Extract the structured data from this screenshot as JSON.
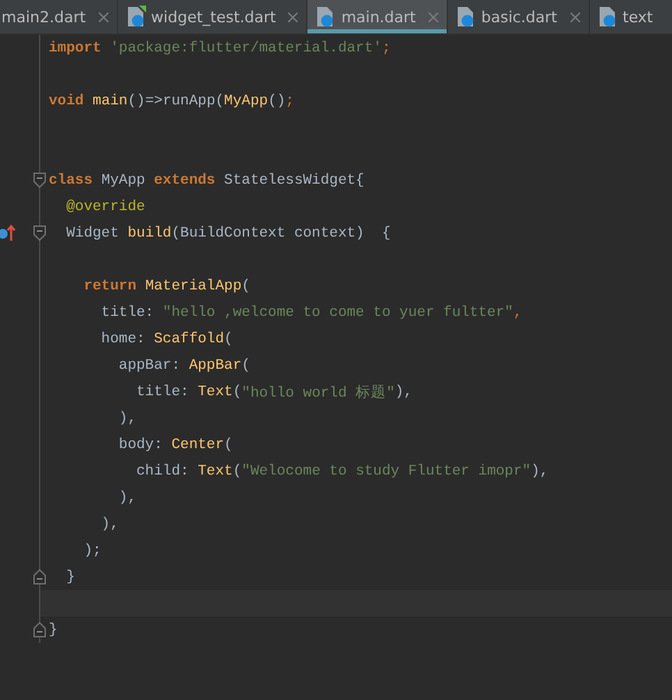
{
  "tabs": [
    {
      "label": "main2.dart",
      "selected": false,
      "icon": false,
      "cut": false
    },
    {
      "label": "widget_test.dart",
      "selected": false,
      "icon": true,
      "badge": true,
      "cut": false
    },
    {
      "label": "main.dart",
      "selected": true,
      "icon": true,
      "badge": false,
      "cut": false
    },
    {
      "label": "basic.dart",
      "selected": false,
      "icon": true,
      "badge": false,
      "cut": false
    },
    {
      "label": "text",
      "selected": false,
      "icon": true,
      "badge": false,
      "cut": true
    }
  ],
  "lines": [
    {
      "tokens": [
        {
          "kind": "keyword",
          "text": "import"
        },
        {
          "kind": "string",
          "text": " 'package:flutter/material.dart'"
        },
        {
          "kind": "punct",
          "text": ";"
        }
      ]
    },
    {
      "kind": "blank"
    },
    {
      "tokens": [
        {
          "kind": "keyword",
          "text": "void"
        },
        {
          "kind": "func",
          "text": " main"
        },
        {
          "kind": "plain",
          "text": "()=>runApp("
        },
        {
          "kind": "func",
          "text": "MyApp"
        },
        {
          "kind": "plain",
          "text": "()"
        },
        {
          "kind": "punct",
          "text": ";"
        }
      ]
    },
    {
      "kind": "blank"
    },
    {
      "kind": "blank"
    },
    {
      "gutter": [
        {
          "kind": "fold_start"
        }
      ],
      "tokens": [
        {
          "kind": "keyword",
          "text": "class"
        },
        {
          "kind": "plain",
          "text": " MyApp "
        },
        {
          "kind": "keyword",
          "text": "extends"
        },
        {
          "kind": "plain",
          "text": " StatelessWidget{"
        }
      ]
    },
    {
      "tokens": [
        {
          "kind": "annotation",
          "text": "  @override"
        }
      ]
    },
    {
      "gutter": [
        {
          "kind": "override_marker"
        },
        {
          "kind": "fold_start"
        }
      ],
      "tokens": [
        {
          "kind": "plain",
          "text": "  Widget "
        },
        {
          "kind": "func",
          "text": "build"
        },
        {
          "kind": "plain",
          "text": "(BuildContext context)  {"
        }
      ]
    },
    {
      "kind": "blank"
    },
    {
      "tokens": [
        {
          "kind": "keyword",
          "text": "    return"
        },
        {
          "kind": "func",
          "text": " MaterialApp"
        },
        {
          "kind": "plain",
          "text": "("
        }
      ]
    },
    {
      "tokens": [
        {
          "kind": "plain",
          "text": "      title: "
        },
        {
          "kind": "string",
          "text": "\"hello ,welcome to come to yuer fultter\""
        },
        {
          "kind": "punct",
          "text": ","
        }
      ]
    },
    {
      "tokens": [
        {
          "kind": "plain",
          "text": "      home: "
        },
        {
          "kind": "func",
          "text": "Scaffold"
        },
        {
          "kind": "plain",
          "text": "("
        }
      ]
    },
    {
      "tokens": [
        {
          "kind": "plain",
          "text": "        appBar: "
        },
        {
          "kind": "func",
          "text": "AppBar"
        },
        {
          "kind": "plain",
          "text": "("
        }
      ]
    },
    {
      "tokens": [
        {
          "kind": "plain",
          "text": "          title: "
        },
        {
          "kind": "func",
          "text": "Text"
        },
        {
          "kind": "plain",
          "text": "("
        },
        {
          "kind": "string",
          "text": "\"hollo world 标题\""
        },
        {
          "kind": "plain",
          "text": "),"
        }
      ]
    },
    {
      "tokens": [
        {
          "kind": "plain",
          "text": "        ),"
        }
      ]
    },
    {
      "tokens": [
        {
          "kind": "plain",
          "text": "        body: "
        },
        {
          "kind": "func",
          "text": "Center"
        },
        {
          "kind": "plain",
          "text": "("
        }
      ]
    },
    {
      "tokens": [
        {
          "kind": "plain",
          "text": "          child: "
        },
        {
          "kind": "func",
          "text": "Text"
        },
        {
          "kind": "plain",
          "text": "("
        },
        {
          "kind": "string",
          "text": "\"Welocome to study Flutter imopr\""
        },
        {
          "kind": "plain",
          "text": "),"
        }
      ]
    },
    {
      "tokens": [
        {
          "kind": "plain",
          "text": "        ),"
        }
      ]
    },
    {
      "tokens": [
        {
          "kind": "plain",
          "text": "      ),"
        }
      ]
    },
    {
      "tokens": [
        {
          "kind": "plain",
          "text": "    );"
        }
      ]
    },
    {
      "gutter": [
        {
          "kind": "fold_end"
        }
      ],
      "tokens": [
        {
          "kind": "plain",
          "text": "  }"
        }
      ]
    },
    {
      "kind": "current_line"
    },
    {
      "gutter": [
        {
          "kind": "fold_end"
        }
      ],
      "tokens": [
        {
          "kind": "plain",
          "text": "}"
        }
      ]
    }
  ]
}
